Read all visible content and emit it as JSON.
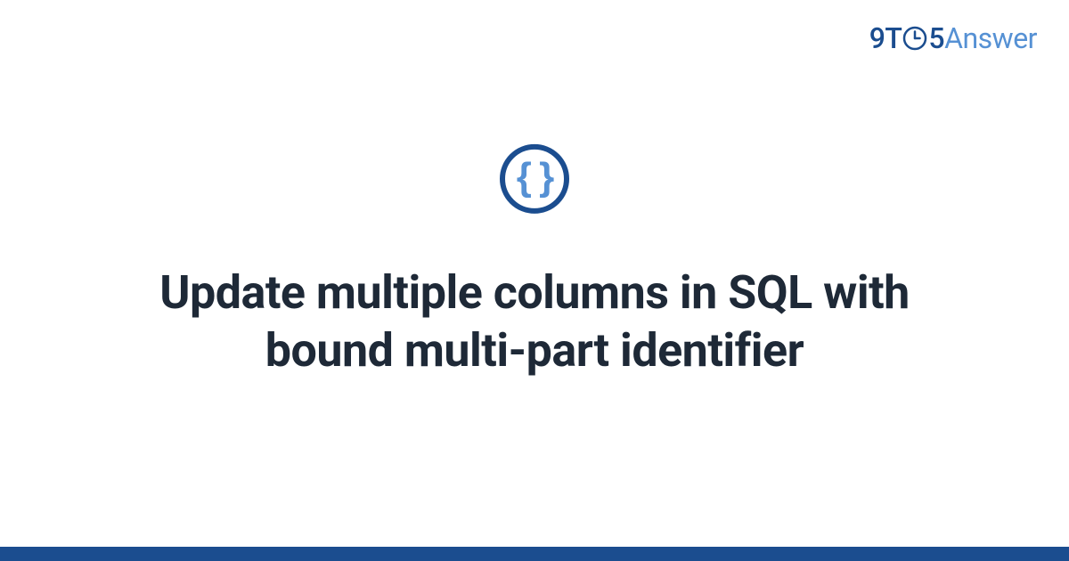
{
  "logo": {
    "part1": "9T",
    "part2": "5",
    "part3": "Answer"
  },
  "icon": {
    "braces": "{ }"
  },
  "title": "Update multiple columns in SQL with bound multi-part identifier",
  "colors": {
    "dark_blue": "#1b4d8f",
    "light_blue": "#5691d4",
    "text_dark": "#1e2937"
  }
}
